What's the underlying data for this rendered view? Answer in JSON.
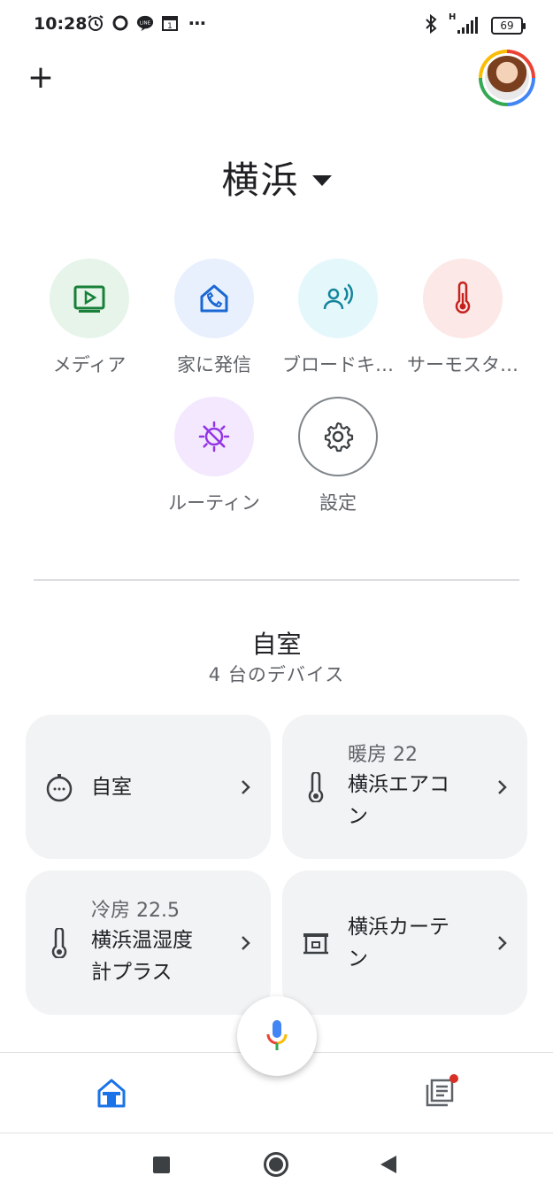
{
  "status_bar": {
    "time": "10:28",
    "left_icons": [
      "alarm-icon",
      "ring-icon",
      "line-app-icon",
      "calendar-icon",
      "more-dots-icon"
    ],
    "calendar_day": "1",
    "line_label": "LINE",
    "more": "⋯",
    "network": "H",
    "battery": "69"
  },
  "header": {
    "add_symbol": "+",
    "home_name": "横浜"
  },
  "actions": [
    {
      "label": "メディア",
      "icon": "media-play-icon",
      "color": "#e6f4ea",
      "icon_color": "#188038"
    },
    {
      "label": "家に発信",
      "icon": "call-home-icon",
      "color": "#e8f0fe",
      "icon_color": "#1967d2"
    },
    {
      "label": "ブロードキャスト",
      "display": "ブロードキ…",
      "icon": "broadcast-icon",
      "color": "#e4f7fb",
      "icon_color": "#12849a"
    },
    {
      "label": "サーモスタット",
      "display": "サーモスタ…",
      "icon": "thermometer-icon",
      "color": "#fce8e6",
      "icon_color": "#c5221f"
    },
    {
      "label": "ルーティン",
      "icon": "routine-icon",
      "color": "#f3e8fd",
      "icon_color": "#9334e6"
    },
    {
      "label": "設定",
      "icon": "gear-icon",
      "color": "#ffffff",
      "icon_color": "#3c4043"
    }
  ],
  "room": {
    "title": "自室",
    "subtitle": "4 台のデバイス"
  },
  "devices": [
    {
      "status": "",
      "name_lines": [
        "自室"
      ],
      "icon": "hub-icon"
    },
    {
      "status": "暖房 22",
      "name_lines": [
        "横浜エアコ",
        "ン"
      ],
      "icon": "thermometer-icon"
    },
    {
      "status": "冷房 22.5",
      "name_lines": [
        "横浜温湿度",
        "計プラス"
      ],
      "icon": "thermometer-icon"
    },
    {
      "status": "",
      "name_lines": [
        "横浜カーテ",
        "ン"
      ],
      "icon": "curtain-icon"
    }
  ],
  "bottom_nav": {
    "items": [
      {
        "icon": "home-icon",
        "active": true
      },
      {
        "icon": "feed-icon",
        "badge": true
      }
    ]
  },
  "colors": {
    "accent": "#1a73e8",
    "card_bg": "#f1f3f4",
    "badge": "#d93025"
  }
}
